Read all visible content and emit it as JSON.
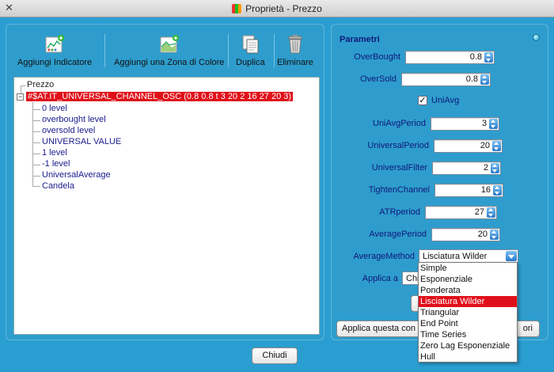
{
  "window": {
    "title": "Proprietà - Prezzo",
    "close_glyph": "✕"
  },
  "toolbar": {
    "add_indicator": "Aggiungi Indicatore",
    "add_color_zone": "Aggiungi una Zona di Colore",
    "duplicate": "Duplica",
    "delete": "Eliminare"
  },
  "tree": {
    "root": "Prezzo",
    "expander": "−",
    "selected": "#$AT.IT_UNIVERSAL_CHANNEL_OSC (0.8 0.8 t 3 20 2 16 27 20 3)",
    "children": [
      "0 level",
      "overbought level",
      "oversold level",
      "UNIVERSAL VALUE",
      "1 level",
      "-1 level",
      "UniversalAverage",
      "Candela"
    ]
  },
  "params": {
    "title": "Parametri",
    "overbought": {
      "label": "OverBought",
      "value": "0.8"
    },
    "oversold": {
      "label": "OverSold",
      "value": "0.8"
    },
    "uniavg": {
      "label": "UniAvg",
      "check": "✓"
    },
    "uniavg_period": {
      "label": "UniAvgPeriod",
      "value": "3"
    },
    "universal_period": {
      "label": "UniversalPeriod",
      "value": "20"
    },
    "universal_filter": {
      "label": "UniversalFilter",
      "value": "2"
    },
    "tighten_channel": {
      "label": "TightenChannel",
      "value": "16"
    },
    "atr_period": {
      "label": "ATRperiod",
      "value": "27"
    },
    "average_period": {
      "label": "AveragePeriod",
      "value": "20"
    },
    "average_method": {
      "label": "AverageMethod",
      "value": "Lisciatura Wilder"
    },
    "apply_to": {
      "label": "Applica a",
      "value": "Chi"
    },
    "apply_button": {
      "left": "Applica questa con",
      "right": "ori"
    }
  },
  "dropdown": {
    "options": [
      "Simple",
      "Esponenziale",
      "Ponderata",
      "Lisciatura Wilder",
      "Triangular",
      "End Point",
      "Time Series",
      "Zero Lag Esponenziale",
      "Hull"
    ],
    "selected_index": 3
  },
  "footer": {
    "close": "Chiudi"
  },
  "colors": {
    "accent": "#2a9ed1",
    "selection": "#e0101a",
    "label": "#10187a"
  }
}
